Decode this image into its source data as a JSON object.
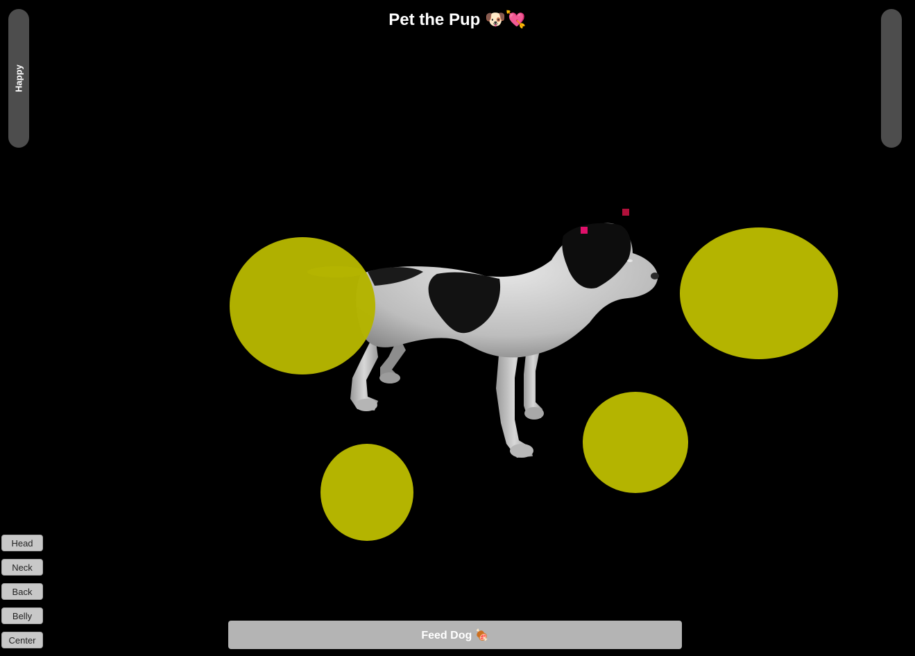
{
  "title": "Pet the Pup 🐶💘",
  "mood_meter": {
    "label": "Happy"
  },
  "target_color": "#b4b400",
  "marker_color": "#e0106a",
  "body_part_buttons": [
    {
      "label": "Head"
    },
    {
      "label": "Neck"
    },
    {
      "label": "Back"
    },
    {
      "label": "Belly"
    },
    {
      "label": "Center"
    }
  ],
  "feed_button": {
    "label": "Feed Dog 🍖"
  }
}
